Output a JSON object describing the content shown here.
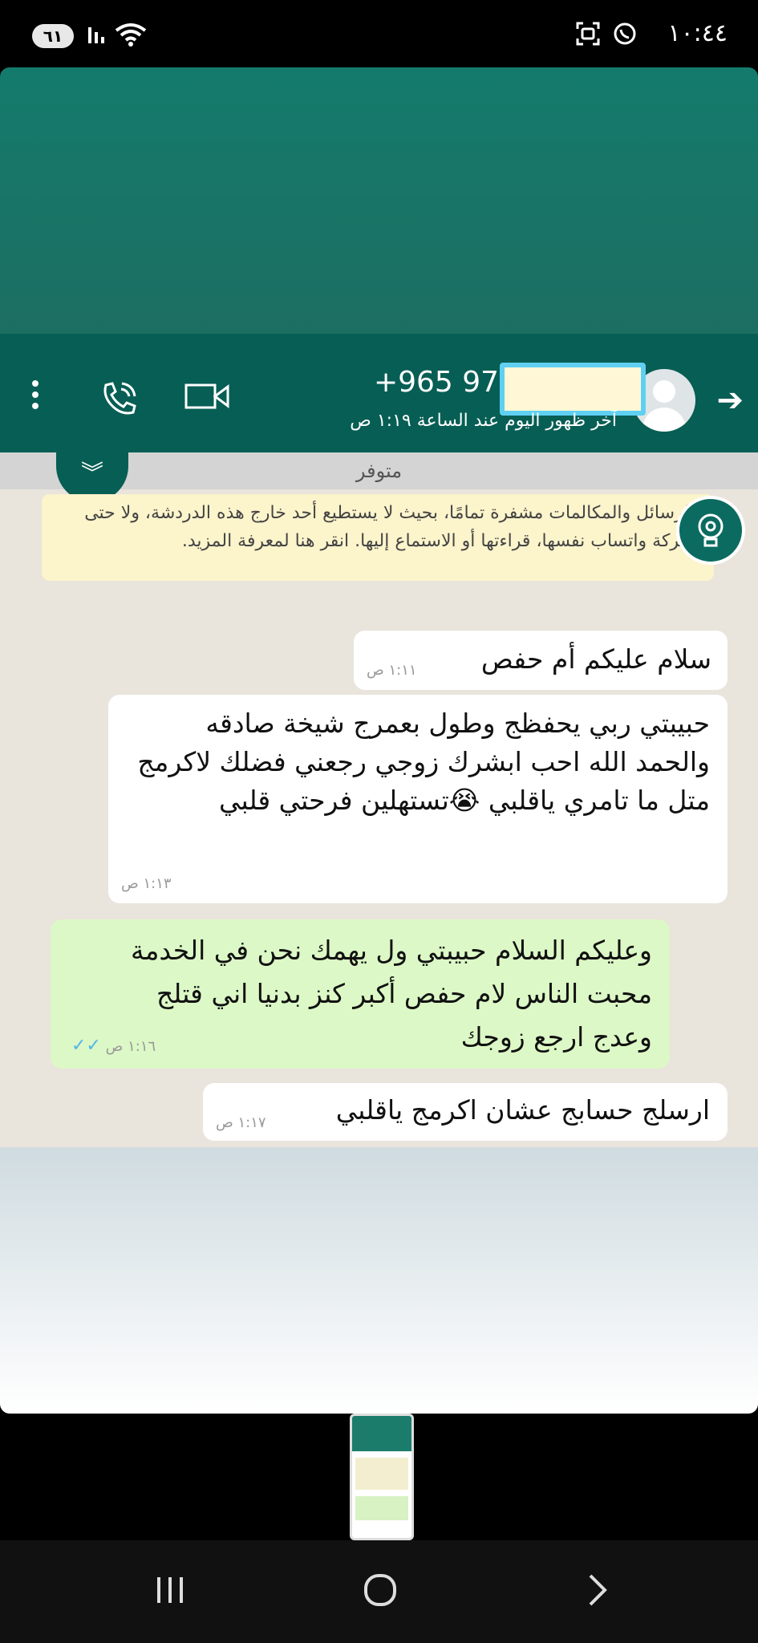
{
  "status_bar": {
    "time": "١٠:٤٤",
    "battery": "٦١"
  },
  "header": {
    "contact_number": "+965 971",
    "last_seen": "آخر ظهور اليوم عند الساعة ١:١٩ ص"
  },
  "chat": {
    "status": "متوفر",
    "encryption_note": "الرسائل والمكالمات مشفرة تمامًا، بحيث لا يستطيع أحد خارج هذه الدردشة، ولا حتى شركة واتساب نفسها، قراءتها أو الاستماع إليها. انقر هنا لمعرفة المزيد.",
    "messages": [
      {
        "direction": "in",
        "text": "سلام عليكم  أم حفص",
        "time": "١:١١ ص"
      },
      {
        "direction": "in",
        "text": "حبيبتي ربي يحفظج وطول بعمرج شيخة صادقه والحمد الله احب ابشرك زوجي رجعني فضلك لاكرمج متل ما تامري ياقلبي 😭تستهلين فرحتي قلبي",
        "time": "١:١٣ ص"
      },
      {
        "direction": "out",
        "text": "وعليكم السلام حبيبتي ول يهمك نحن في الخدمة محبت الناس لام حفص أكبر كنز بدنيا اني قتلج وعدج ارجع زوجك",
        "time": "١:١٦ ص"
      },
      {
        "direction": "in",
        "text": "ارسلج حسابج عشان اكرمج ياقلبي",
        "time": "١:١٧ ص"
      }
    ]
  },
  "icons": {
    "whatsapp": "whatsapp-icon",
    "screenshot": "screenshot-icon",
    "call": "voice-call-icon",
    "video": "video-call-icon",
    "menu": "more-vert-icon",
    "back": "back-arrow-icon",
    "chevron": "chevron-double-down-icon",
    "fab": "lightbulb-gear-icon"
  },
  "colors": {
    "header": "#075e54",
    "outgoing_bubble": "#dcf8c6",
    "incoming_bubble": "#ffffff",
    "encryption_note": "#fcf4cb",
    "read_ticks": "#4fb6ec"
  }
}
